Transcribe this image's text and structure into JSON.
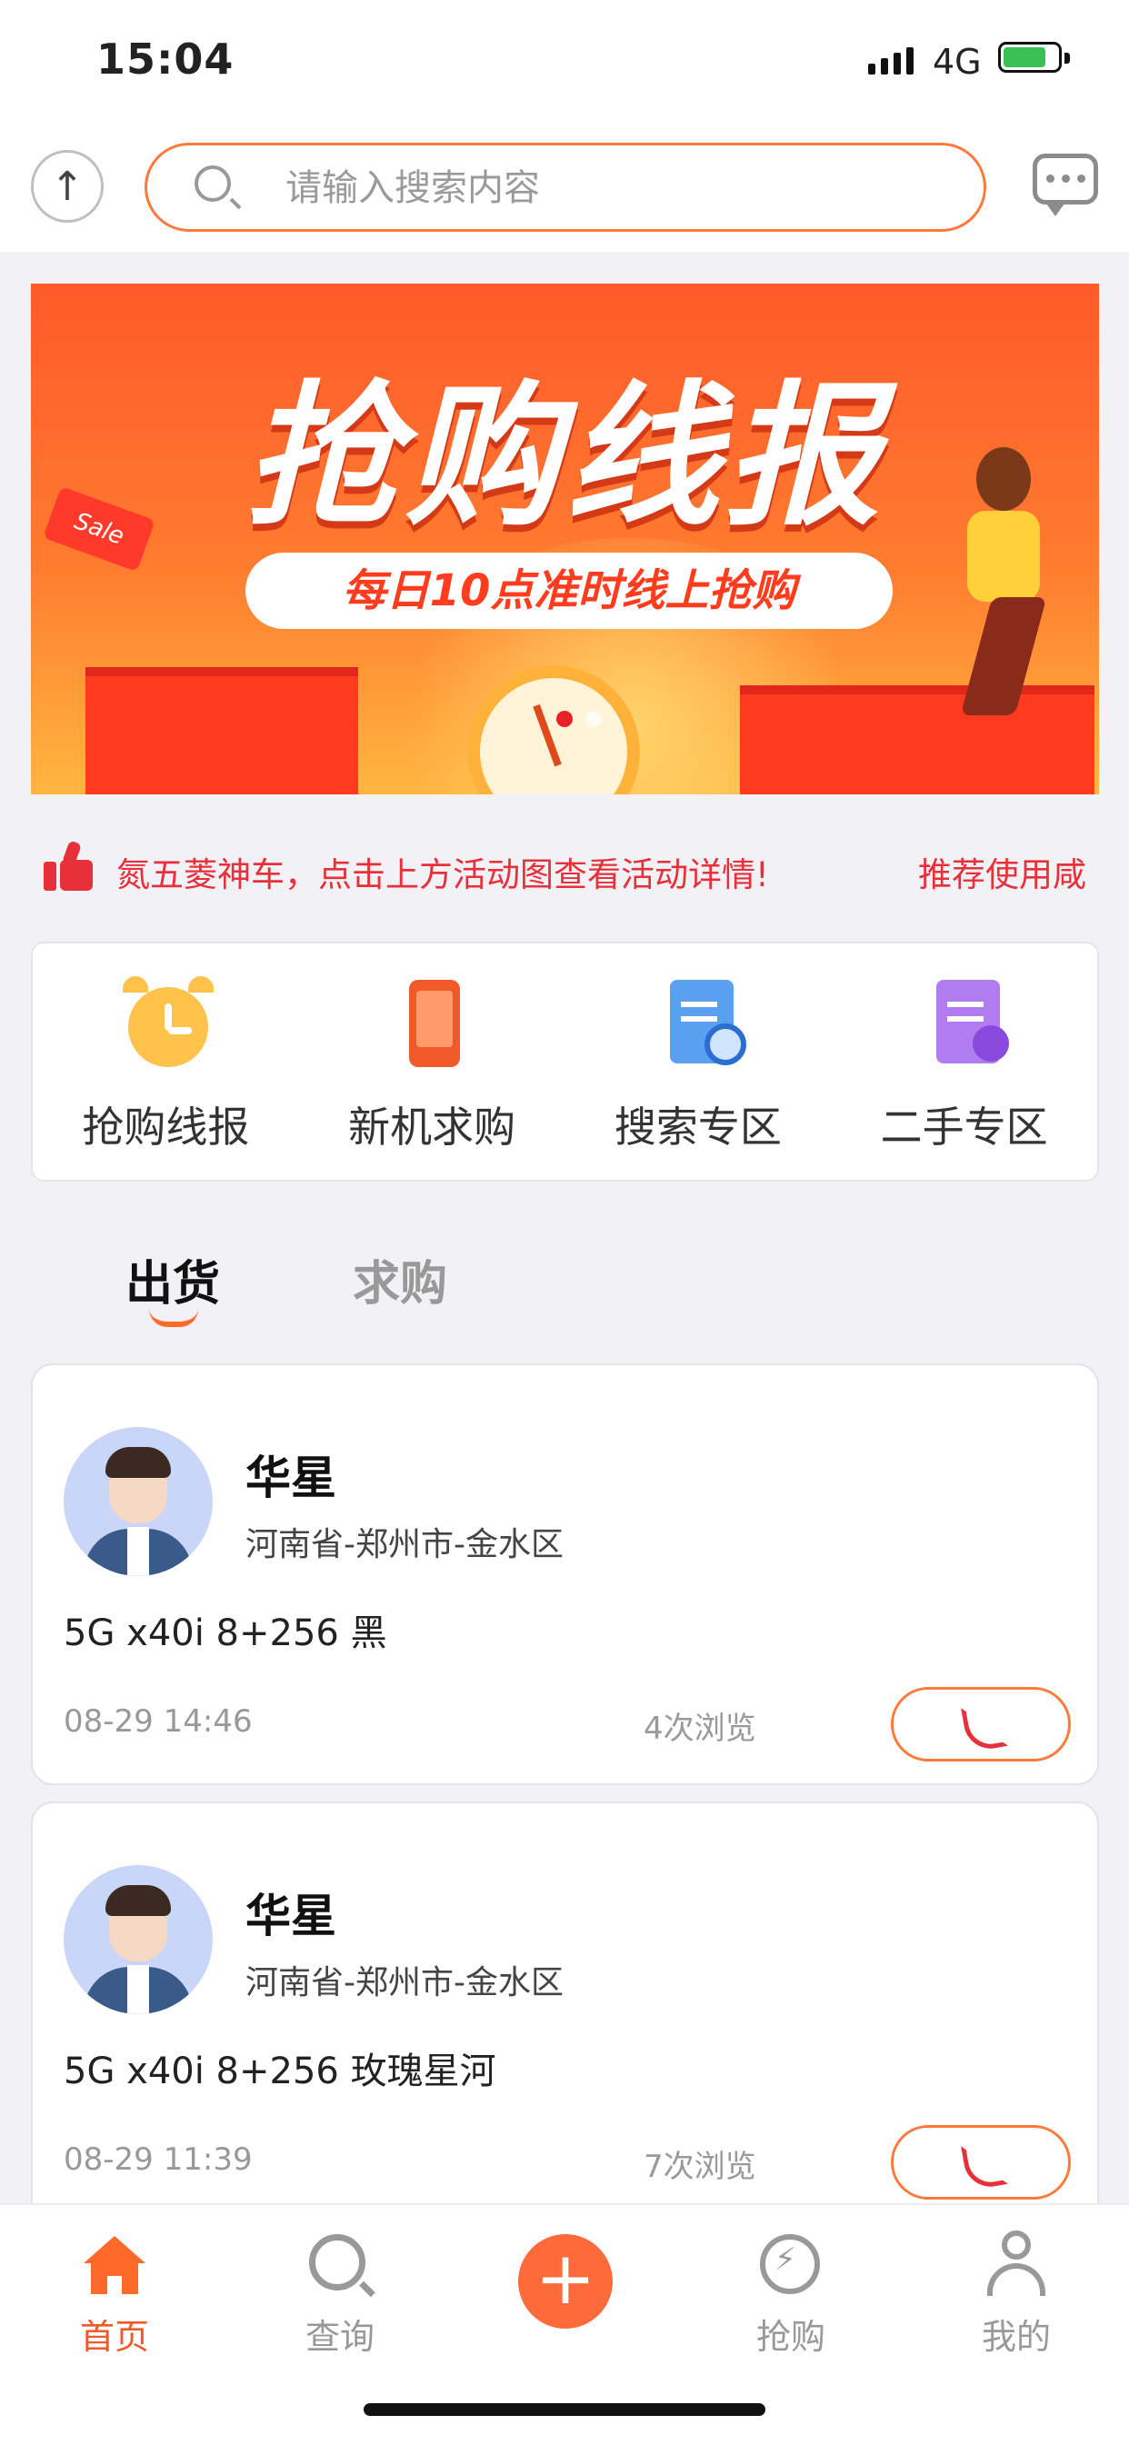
{
  "status_bar": {
    "time": "15:04",
    "network": "4G"
  },
  "search": {
    "placeholder": "请输入搜索内容"
  },
  "banner": {
    "title": "抢购线报",
    "subtitle": "每日10点准时线上抢购",
    "tag": "Sale"
  },
  "notice": {
    "text": "氮五菱神车，点击上方活动图查看活动详情!",
    "text_right": "推荐使用咸"
  },
  "quick_menu": [
    {
      "label": "抢购线报",
      "icon": "alarm-clock-icon"
    },
    {
      "label": "新机求购",
      "icon": "phone-icon"
    },
    {
      "label": "搜索专区",
      "icon": "search-document-icon"
    },
    {
      "label": "二手专区",
      "icon": "document-list-icon"
    }
  ],
  "tabs": [
    {
      "label": "出货",
      "active": true
    },
    {
      "label": "求购",
      "active": false
    }
  ],
  "listings": [
    {
      "name": "华星",
      "address": "河南省-郑州市-金水区",
      "desc": "5G x40i 8+256 黑",
      "date": "08-29 14:46",
      "views": "4次浏览"
    },
    {
      "name": "华星",
      "address": "河南省-郑州市-金水区",
      "desc": "5G x40i 8+256 玫瑰星河",
      "date": "08-29 11:39",
      "views": "7次浏览"
    }
  ],
  "tabbar": {
    "home": "首页",
    "query": "查询",
    "grab": "抢购",
    "me": "我的"
  },
  "colors": {
    "accent": "#ff6a2a",
    "notice_red": "#e8303a"
  }
}
